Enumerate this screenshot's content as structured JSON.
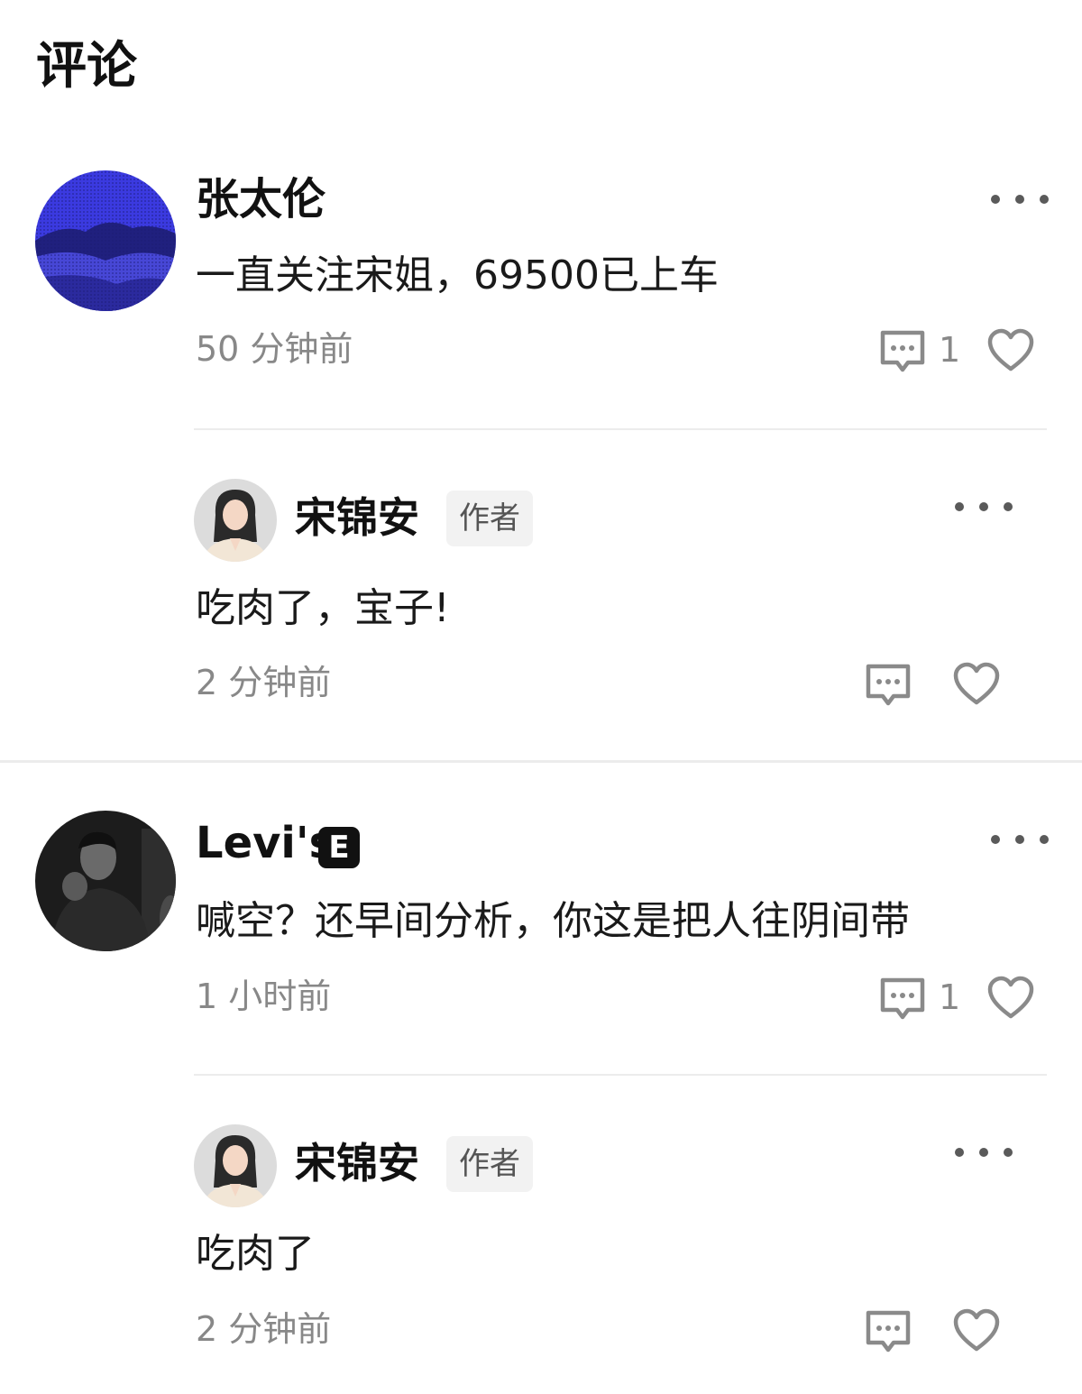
{
  "header": {
    "title": "评论"
  },
  "comments": [
    {
      "user": "张太伦",
      "text": "一直关注宋姐，69500已上车",
      "time": "50 分钟前",
      "reply_count": "1",
      "reply": {
        "user": "宋锦安",
        "badge": "作者",
        "text": "吃肉了，宝子!",
        "time": "2 分钟前"
      }
    },
    {
      "user": "Levi's",
      "user_badge": "E",
      "text": "喊空？还早间分析，你这是把人往阴间带",
      "time": "1 小时前",
      "reply_count": "1",
      "reply": {
        "user": "宋锦安",
        "badge": "作者",
        "text": "吃肉了",
        "time": "2 分钟前"
      }
    }
  ],
  "icons": {
    "more": "more-dots-icon",
    "comment": "comment-bubble-icon",
    "like": "heart-icon"
  },
  "colors": {
    "text_primary": "#111111",
    "text_secondary": "#888888",
    "divider": "#ececec",
    "badge_bg": "#f2f2f2",
    "avatar_blue": "#3b3ae0"
  }
}
